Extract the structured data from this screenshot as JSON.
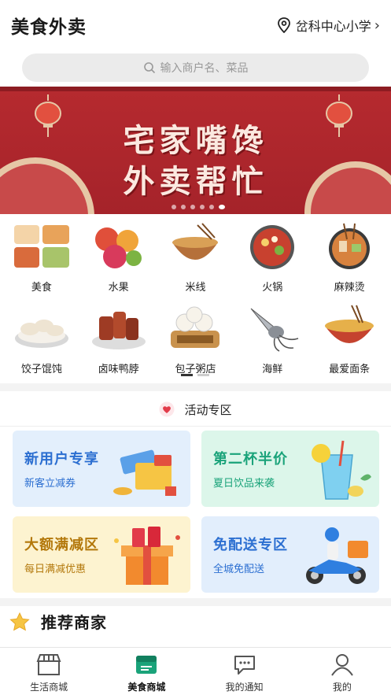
{
  "header": {
    "title": "美食外卖",
    "location": "岔科中心小学"
  },
  "search": {
    "placeholder": "输入商户名、菜品"
  },
  "banner": {
    "line1": "宅家嘴馋",
    "line2": "外卖帮忙",
    "slide_count": 6,
    "active_slide": 6
  },
  "categories": [
    {
      "label": "美食",
      "icon": "food-icon",
      "color": "#e8a35a"
    },
    {
      "label": "水果",
      "icon": "fruit-icon",
      "color": "#e04f3a"
    },
    {
      "label": "米线",
      "icon": "rice-noodle-icon",
      "color": "#b5703a"
    },
    {
      "label": "火锅",
      "icon": "hotpot-icon",
      "color": "#c8412f"
    },
    {
      "label": "麻辣烫",
      "icon": "malatang-icon",
      "color": "#d7823e"
    },
    {
      "label": "饺子馄饨",
      "icon": "dumpling-icon",
      "color": "#e9dcc6"
    },
    {
      "label": "卤味鸭脖",
      "icon": "duck-neck-icon",
      "color": "#9e3b24"
    },
    {
      "label": "包子粥店",
      "icon": "bun-icon",
      "color": "#c9924d"
    },
    {
      "label": "海鲜",
      "icon": "seafood-icon",
      "color": "#8a8f96"
    },
    {
      "label": "最爱面条",
      "icon": "noodle-icon",
      "color": "#e6b04a"
    }
  ],
  "activity": {
    "title": "活动专区"
  },
  "promos": [
    {
      "title": "新用户专享",
      "subtitle": "新客立减券"
    },
    {
      "title": "第二杯半价",
      "subtitle": "夏日饮品来袭"
    },
    {
      "title": "大额满减区",
      "subtitle": "每日满减优惠"
    },
    {
      "title": "免配送专区",
      "subtitle": "全城免配送"
    }
  ],
  "recommend": {
    "title": "推荐商家"
  },
  "tabbar": [
    {
      "label": "生活商城",
      "icon": "store-icon",
      "active": false
    },
    {
      "label": "美食商城",
      "icon": "food-mall-icon",
      "active": true
    },
    {
      "label": "我的通知",
      "icon": "message-icon",
      "active": false
    },
    {
      "label": "我的",
      "icon": "user-icon",
      "active": false
    }
  ],
  "colors": {
    "accent": "#1aa37a",
    "banner": "#b62a2f"
  }
}
